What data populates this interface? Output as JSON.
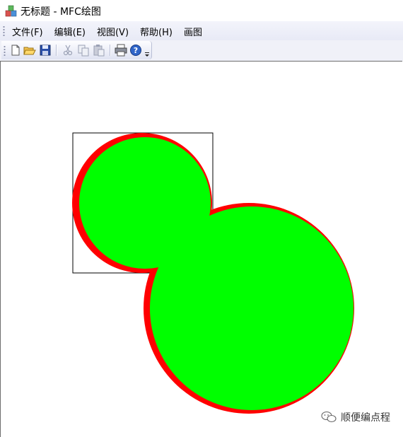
{
  "window": {
    "title": "无标题 - MFC绘图"
  },
  "menu": {
    "items": [
      {
        "label": "文件(F)"
      },
      {
        "label": "编辑(E)"
      },
      {
        "label": "视图(V)"
      },
      {
        "label": "帮助(H)"
      },
      {
        "label": "画图"
      }
    ]
  },
  "toolbar": {
    "buttons": [
      "new-icon",
      "open-icon",
      "save-icon",
      "cut-icon",
      "copy-icon",
      "paste-icon",
      "print-icon",
      "help-icon"
    ]
  },
  "canvas": {
    "background": "#ffffff",
    "fill_color": "#00ff00",
    "outline_color": "#ff0000",
    "rect_color": "#000000"
  },
  "watermark": {
    "text": "顺便编点程"
  }
}
